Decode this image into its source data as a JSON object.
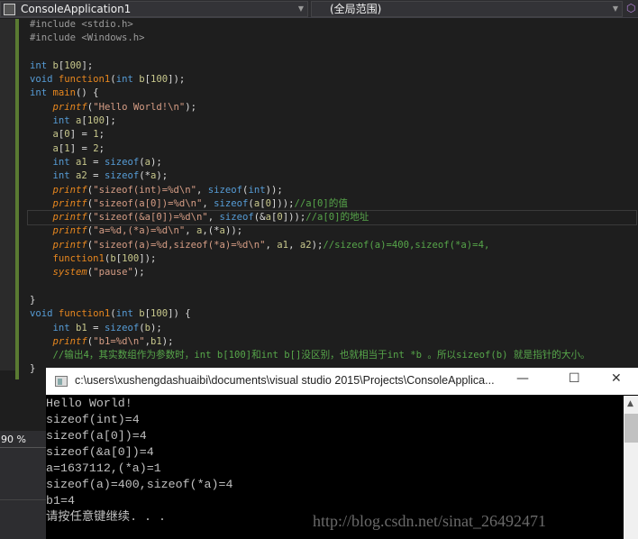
{
  "toolbar": {
    "project": "ConsoleApplication1",
    "scope": "(全局范围)"
  },
  "editor": {
    "current_line": 14,
    "lines": [
      [
        [
          "pp",
          "#include <stdio.h>"
        ]
      ],
      [
        [
          "pp",
          "#include <Windows.h>"
        ]
      ],
      [],
      [
        [
          "k",
          "int "
        ],
        [
          "v",
          "b"
        ],
        [
          "p",
          "["
        ],
        [
          "n",
          "100"
        ],
        [
          "p",
          "];"
        ]
      ],
      [
        [
          "k",
          "void "
        ],
        [
          "f",
          "function1"
        ],
        [
          "p",
          "("
        ],
        [
          "k",
          "int "
        ],
        [
          "v",
          "b"
        ],
        [
          "p",
          "["
        ],
        [
          "n",
          "100"
        ],
        [
          "p",
          "]);"
        ]
      ],
      [
        [
          "k",
          "int "
        ],
        [
          "f",
          "main"
        ],
        [
          "p",
          "() {"
        ]
      ],
      [
        [
          "p",
          "    "
        ],
        [
          "fi",
          "printf"
        ],
        [
          "p",
          "("
        ],
        [
          "s",
          "\"Hello World!\\n\""
        ],
        [
          "p",
          ");"
        ]
      ],
      [
        [
          "p",
          "    "
        ],
        [
          "k",
          "int "
        ],
        [
          "v",
          "a"
        ],
        [
          "p",
          "["
        ],
        [
          "n",
          "100"
        ],
        [
          "p",
          "];"
        ]
      ],
      [
        [
          "p",
          "    "
        ],
        [
          "v",
          "a"
        ],
        [
          "p",
          "["
        ],
        [
          "n",
          "0"
        ],
        [
          "p",
          "] = "
        ],
        [
          "n",
          "1"
        ],
        [
          "p",
          ";"
        ]
      ],
      [
        [
          "p",
          "    "
        ],
        [
          "v",
          "a"
        ],
        [
          "p",
          "["
        ],
        [
          "n",
          "1"
        ],
        [
          "p",
          "] = "
        ],
        [
          "n",
          "2"
        ],
        [
          "p",
          ";"
        ]
      ],
      [
        [
          "p",
          "    "
        ],
        [
          "k",
          "int "
        ],
        [
          "v",
          "a1"
        ],
        [
          "p",
          " = "
        ],
        [
          "k",
          "sizeof"
        ],
        [
          "p",
          "("
        ],
        [
          "v",
          "a"
        ],
        [
          "p",
          ");"
        ]
      ],
      [
        [
          "p",
          "    "
        ],
        [
          "k",
          "int "
        ],
        [
          "v",
          "a2"
        ],
        [
          "p",
          " = "
        ],
        [
          "k",
          "sizeof"
        ],
        [
          "p",
          "(*"
        ],
        [
          "v",
          "a"
        ],
        [
          "p",
          ");"
        ]
      ],
      [
        [
          "p",
          "    "
        ],
        [
          "fi",
          "printf"
        ],
        [
          "p",
          "("
        ],
        [
          "s",
          "\"sizeof(int)=%d\\n\""
        ],
        [
          "p",
          ", "
        ],
        [
          "k",
          "sizeof"
        ],
        [
          "p",
          "("
        ],
        [
          "k",
          "int"
        ],
        [
          "p",
          "));"
        ]
      ],
      [
        [
          "p",
          "    "
        ],
        [
          "fi",
          "printf"
        ],
        [
          "p",
          "("
        ],
        [
          "s",
          "\"sizeof(a[0])=%d\\n\""
        ],
        [
          "p",
          ", "
        ],
        [
          "k",
          "sizeof"
        ],
        [
          "p",
          "("
        ],
        [
          "v",
          "a"
        ],
        [
          "p",
          "["
        ],
        [
          "n",
          "0"
        ],
        [
          "p",
          "]));"
        ],
        [
          "c",
          "//a[0]的值"
        ]
      ],
      [
        [
          "p",
          "    "
        ],
        [
          "fi",
          "printf"
        ],
        [
          "p",
          "("
        ],
        [
          "s",
          "\"sizeof(&a[0])=%d\\n\""
        ],
        [
          "p",
          ", "
        ],
        [
          "k",
          "sizeof"
        ],
        [
          "p",
          "(&"
        ],
        [
          "v",
          "a"
        ],
        [
          "p",
          "["
        ],
        [
          "n",
          "0"
        ],
        [
          "p",
          "]));"
        ],
        [
          "c",
          "//a[0]的地址"
        ]
      ],
      [
        [
          "p",
          "    "
        ],
        [
          "fi",
          "printf"
        ],
        [
          "p",
          "("
        ],
        [
          "s",
          "\"a=%d,(*a)=%d\\n\""
        ],
        [
          "p",
          ", "
        ],
        [
          "v",
          "a"
        ],
        [
          "p",
          ",(*"
        ],
        [
          "v",
          "a"
        ],
        [
          "p",
          "));"
        ]
      ],
      [
        [
          "p",
          "    "
        ],
        [
          "fi",
          "printf"
        ],
        [
          "p",
          "("
        ],
        [
          "s",
          "\"sizeof(a)=%d,sizeof(*a)=%d\\n\""
        ],
        [
          "p",
          ", "
        ],
        [
          "v",
          "a1"
        ],
        [
          "p",
          ", "
        ],
        [
          "v",
          "a2"
        ],
        [
          "p",
          ");"
        ],
        [
          "c",
          "//sizeof(a)=400,sizeof(*a)=4,"
        ]
      ],
      [
        [
          "p",
          "    "
        ],
        [
          "f",
          "function1"
        ],
        [
          "p",
          "("
        ],
        [
          "v",
          "b"
        ],
        [
          "p",
          "["
        ],
        [
          "n",
          "100"
        ],
        [
          "p",
          "]);"
        ]
      ],
      [
        [
          "p",
          "    "
        ],
        [
          "fi",
          "system"
        ],
        [
          "p",
          "("
        ],
        [
          "s",
          "\"pause\""
        ],
        [
          "p",
          ");"
        ]
      ],
      [],
      [
        [
          "p",
          "}"
        ]
      ],
      [
        [
          "k",
          "void "
        ],
        [
          "f",
          "function1"
        ],
        [
          "p",
          "("
        ],
        [
          "k",
          "int "
        ],
        [
          "v",
          "b"
        ],
        [
          "p",
          "["
        ],
        [
          "n",
          "100"
        ],
        [
          "p",
          "]) {"
        ]
      ],
      [
        [
          "p",
          "    "
        ],
        [
          "k",
          "int "
        ],
        [
          "v",
          "b1"
        ],
        [
          "p",
          " = "
        ],
        [
          "k",
          "sizeof"
        ],
        [
          "p",
          "("
        ],
        [
          "v",
          "b"
        ],
        [
          "p",
          ");"
        ]
      ],
      [
        [
          "p",
          "    "
        ],
        [
          "fi",
          "printf"
        ],
        [
          "p",
          "("
        ],
        [
          "s",
          "\"b1=%d\\n\""
        ],
        [
          "p",
          ","
        ],
        [
          "v",
          "b1"
        ],
        [
          "p",
          ");"
        ]
      ],
      [
        [
          "p",
          "    "
        ],
        [
          "c",
          "//输出4，其实数组作为参数时，int b[100]和int b[]没区别，也就相当于int *b 。所以sizeof(b) 就是指针的大小。"
        ]
      ],
      [
        [
          "p",
          "}"
        ]
      ]
    ]
  },
  "status": {
    "zoom": "90 %"
  },
  "console": {
    "title": "c:\\users\\xushengdashuaibi\\documents\\visual studio 2015\\Projects\\ConsoleApplica...",
    "minimize": "—",
    "maximize": "☐",
    "close": "✕",
    "lines": [
      "Hello World!",
      "sizeof(int)=4",
      "sizeof(a[0])=4",
      "sizeof(&a[0])=4",
      "a=1637112,(*a)=1",
      "sizeof(a)=400,sizeof(*a)=4",
      "b1=4",
      "请按任意键继续. . ."
    ],
    "watermark": "http://blog.csdn.net/sinat_26492471"
  }
}
